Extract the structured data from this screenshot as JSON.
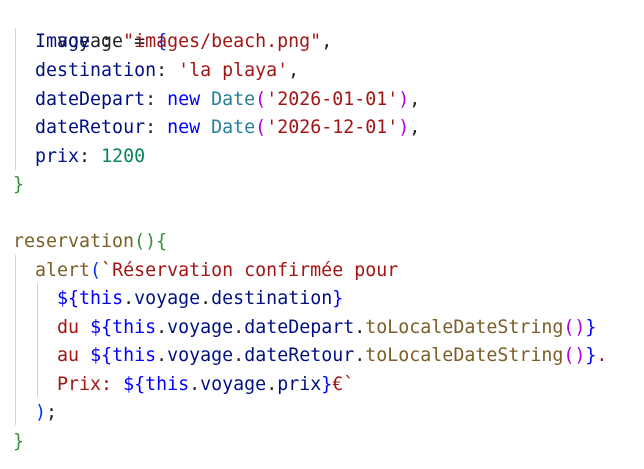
{
  "code": {
    "l1": {
      "name": "voyage",
      "eq": " = ",
      "brace": "{"
    },
    "l2": {
      "key": "Image",
      "sep": " : ",
      "val": "\"images/beach.png\"",
      "end": ","
    },
    "l3": {
      "key": "destination",
      "sep": ": ",
      "val": "'la playa'",
      "end": ","
    },
    "l4": {
      "key": "dateDepart",
      "sep": ": ",
      "kw": "new",
      "sp": " ",
      "type": "Date",
      "po": "(",
      "val": "'2026-01-01'",
      "pc": ")",
      "end": ","
    },
    "l5": {
      "key": "dateRetour",
      "sep": ": ",
      "kw": "new",
      "sp": " ",
      "type": "Date",
      "po": "(",
      "val": "'2026-12-01'",
      "pc": ")",
      "end": ","
    },
    "l6": {
      "key": "prix",
      "sep": ": ",
      "num": "1200"
    },
    "l7": {
      "brace": "}"
    },
    "l9": {
      "fn": "reservation",
      "parens": "()",
      "brace": "{"
    },
    "l10": {
      "fn": "alert",
      "po": "(",
      "str": "`Réservation confirmée pour"
    },
    "l11": {
      "open": "${",
      "this": "this",
      "dot1": ".",
      "voyage": "voyage",
      "dot2": ".",
      "prop": "destination",
      "close": "}"
    },
    "l12": {
      "pre": "du ",
      "open": "${",
      "this": "this",
      "dot1": ".",
      "voyage": "voyage",
      "dot2": ".",
      "prop": "dateDepart",
      "dot3": ".",
      "method": "toLocaleDateString",
      "parens": "()",
      "close": "}"
    },
    "l13": {
      "pre": "au ",
      "open": "${",
      "this": "this",
      "dot1": ".",
      "voyage": "voyage",
      "dot2": ".",
      "prop": "dateRetour",
      "dot3": ".",
      "method": "toLocaleDateString",
      "parens": "()",
      "close": "}",
      "post": "."
    },
    "l14": {
      "pre": "Prix: ",
      "open": "${",
      "this": "this",
      "dot1": ".",
      "voyage": "voyage",
      "dot2": ".",
      "prop": "prix",
      "close": "}",
      "post": "€`"
    },
    "l15": {
      "pc": ")",
      "semi": ";"
    },
    "l16": {
      "brace": "}"
    }
  },
  "colors": {
    "background": "#ffffff",
    "purple": "#af00db",
    "variable": "#001080",
    "brace_green": "#319331",
    "paren_blue": "#0431fa",
    "string": "#a31515",
    "keyword": "#0000ff",
    "type": "#267f99",
    "number": "#098658",
    "function": "#795e26"
  }
}
